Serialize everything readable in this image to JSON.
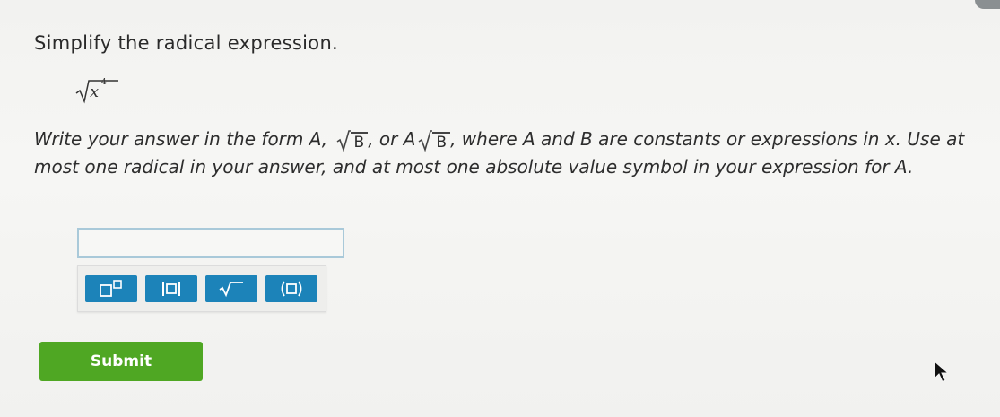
{
  "question": {
    "title": "Simplify the radical expression.",
    "expression": {
      "radicand_base": "x",
      "radicand_exponent": "4"
    },
    "instructions": {
      "part1": "Write your answer in the form A,",
      "form_b_radicand": "B",
      "part2": ", or A",
      "form_ab_radicand": "B",
      "part3": ", where A and B are constants or expressions in x. Use at most one radical in your answer, and at most one absolute value symbol in your expression for A."
    }
  },
  "answer": {
    "value": "",
    "placeholder": ""
  },
  "toolbar": {
    "buttons": [
      {
        "name": "superscript",
        "icon": "superscript-icon"
      },
      {
        "name": "absolute-value",
        "icon": "absolute-value-icon"
      },
      {
        "name": "square-root",
        "icon": "square-root-icon"
      },
      {
        "name": "parentheses",
        "icon": "parentheses-icon"
      }
    ],
    "button_color": "#1c83b9"
  },
  "submit": {
    "label": "Submit",
    "color": "#4fa723"
  }
}
